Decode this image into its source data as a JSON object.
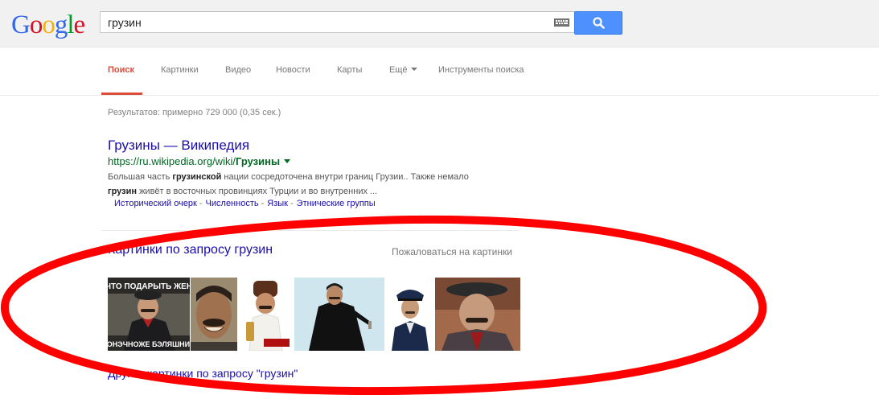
{
  "logo": {
    "letters": [
      "G",
      "o",
      "o",
      "g",
      "l",
      "e"
    ],
    "colors": [
      "#3369e8",
      "#d50f25",
      "#eeb211",
      "#3369e8",
      "#009925",
      "#d50f25"
    ]
  },
  "search": {
    "query": "грузин"
  },
  "nav": {
    "tabs": [
      {
        "label": "Поиск"
      },
      {
        "label": "Картинки"
      },
      {
        "label": "Видео"
      },
      {
        "label": "Новости"
      },
      {
        "label": "Карты"
      },
      {
        "label": "Ещё"
      },
      {
        "label": "Инструменты поиска"
      }
    ]
  },
  "stats": "Результатов: примерно 729 000 (0,35 сек.)",
  "result": {
    "title": "Грузины — Википедия",
    "url_prefix": "https://ru.wikipedia.org/wiki/",
    "url_bold": "Грузины",
    "snippet_1a": "Большая часть ",
    "snippet_1b": "грузинской",
    "snippet_1c": " нации сосредоточена внутри границ Грузии.. Также немало",
    "snippet_2a": "грузин",
    "snippet_2b": " живёт в восточных провинциях Турции и во внутренних ...",
    "sitelinks": [
      "Исторический очерк",
      "Численность",
      "Язык",
      "Этнические группы"
    ],
    "sitelink_sep": "-"
  },
  "images": {
    "heading": "Картинки по запросу грузин",
    "report": "Пожаловаться на картинки",
    "thumb1_top": "ЧТО ПОДАРЫТЬ ЖЕН",
    "thumb1_bottom": "КОНЭЧНОЖЕ БЭЛЯШНИЦ",
    "more": "Другие картинки по запросу \"грузин\""
  },
  "accent": {
    "annotation_red": "#ff0000",
    "link_blue": "#1a0dab",
    "nav_red": "#dd4b39",
    "button_blue": "#4d90fe"
  }
}
